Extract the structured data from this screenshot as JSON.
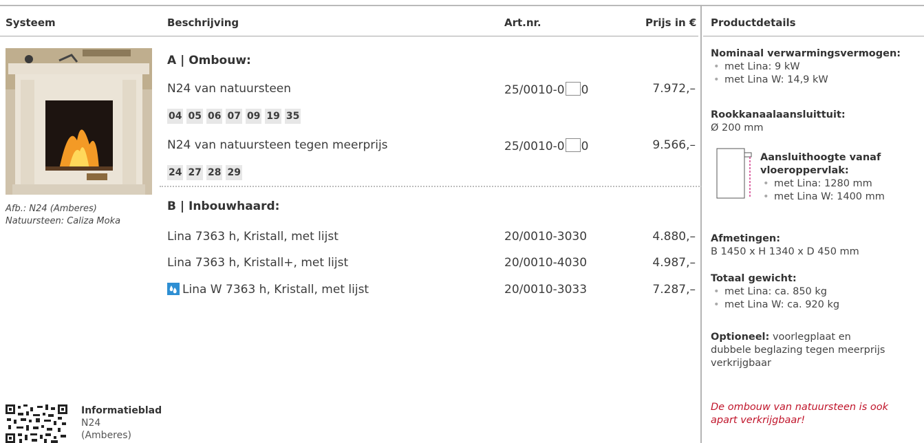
{
  "header": {
    "systeem": "Systeem",
    "beschrijving": "Beschrijving",
    "artnr": "Art.nr.",
    "prijs": "Prijs in €",
    "productdetails": "Productdetails"
  },
  "image": {
    "caption_line1": "Afb.: N24 (Amberes)",
    "caption_line2": "Natuursteen: Caliza Moka"
  },
  "section_a": {
    "title": "A | Ombouw:",
    "rows": [
      {
        "desc": "N24 van natuursteen",
        "art_prefix": "25/0010-0",
        "art_suffix": "0",
        "price": "7.972,–"
      },
      {
        "desc": "N24 van natuursteen tegen meerprijs",
        "art_prefix": "25/0010-0",
        "art_suffix": "0",
        "price": "9.566,–"
      }
    ],
    "tags_1": [
      "04",
      "05",
      "06",
      "07",
      "09",
      "19",
      "35"
    ],
    "tags_2": [
      "24",
      "27",
      "28",
      "29"
    ]
  },
  "section_b": {
    "title": "B | Inbouwhaard:",
    "rows": [
      {
        "desc": "Lina 7363 h, Kristall, met lijst",
        "art": "20/0010-3030",
        "price": "4.880,–"
      },
      {
        "desc": "Lina 7363 h, Kristall+, met lijst",
        "art": "20/0010-4030",
        "price": "4.987,–"
      },
      {
        "desc": "Lina W 7363 h, Kristall, met lijst",
        "art": "20/0010-3033",
        "price": "7.287,–",
        "icon": "water-drops-icon"
      }
    ]
  },
  "info": {
    "title": "Informatieblad",
    "line1": "N24",
    "line2": "(Amberes)"
  },
  "details": {
    "nominaal_label": "Nominaal verwarmingsvermogen:",
    "nominaal_items": [
      "met Lina: 9 kW",
      "met Lina W: 14,9 kW"
    ],
    "rookkanaal_label": "Rookkanaalaansluittuit:",
    "rookkanaal_value": "Ø 200 mm",
    "aansluit_label_1": "Aansluithoogte vanaf",
    "aansluit_label_2": "vloeroppervlak:",
    "aansluit_items": [
      "met Lina: 1280 mm",
      "met Lina W: 1400 mm"
    ],
    "afmetingen_label": "Afmetingen:",
    "afmetingen_value": "B 1450 x H 1340 x D 450 mm",
    "gewicht_label": "Totaal gewicht:",
    "gewicht_items": [
      "met Lina: ca. 850 kg",
      "met Lina W: ca. 920 kg"
    ],
    "optioneel_label": "Optioneel:",
    "optioneel_line1": " voorlegplaat en",
    "optioneel_line2": "dubbele beglazing tegen meerprijs",
    "optioneel_line3": "verkrijgbaar",
    "note_line1": "De ombouw van natuursteen is ook",
    "note_line2": "apart verkrijgbaar!"
  },
  "colors": {
    "accent_red": "#c0142a",
    "water_icon_blue": "#2e8fd3",
    "tag_bg": "#e7e7e7",
    "pink_marker": "#d23c8c"
  }
}
